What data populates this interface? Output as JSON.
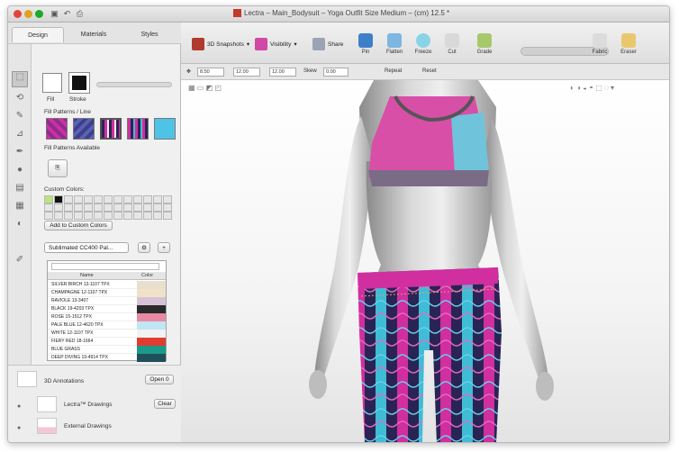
{
  "window": {
    "title": "Lectra – Main_Bodysuit – Yoga Outfit Size Medium – (cm) 12.5 *"
  },
  "tabs": [
    {
      "label": "Design"
    },
    {
      "label": "Materials"
    },
    {
      "label": "Styles"
    }
  ],
  "toolbar": {
    "snapshots_label": "3D Snapshots",
    "visibility_label": "Visibility",
    "share_label": "Share",
    "tools": [
      {
        "label": "Pin"
      },
      {
        "label": "Flatten"
      },
      {
        "label": "Freeze"
      },
      {
        "label": "Cut"
      },
      {
        "label": "Grade"
      },
      {
        "label": "Fabric"
      },
      {
        "label": "Eraser"
      }
    ]
  },
  "properties": {
    "size_value": "8.50",
    "width_value": "12.00",
    "height_value": "12.00",
    "skew_label": "Skew",
    "angle_value": "0.00",
    "repeat_label": "Repeat",
    "reset_label": "Reset"
  },
  "fill_panel": {
    "fill_label": "Fill",
    "stroke_label": "Stroke",
    "patterns_label": "Fill Patterns / Line",
    "recent_label": "Fill Patterns Available",
    "custom_colors_label": "Custom Colors:",
    "add_custom_button": "Add to Custom Colors",
    "library_select": "Sublimated CC400 Pal...",
    "table_headers": {
      "name": "Name",
      "color": "Color"
    },
    "colors": [
      {
        "name": "SILVER BIRCH 13-1107 TPX",
        "hex": "#e9dfce"
      },
      {
        "name": "CHAMPAGNE 12-1107 TPX",
        "hex": "#f0e2c8"
      },
      {
        "name": "RAVIOLE 13-3407",
        "hex": "#d5c2d8"
      },
      {
        "name": "BLACK 19-4203 TPX",
        "hex": "#2a2a2a"
      },
      {
        "name": "ROSE 15-1512 TPX",
        "hex": "#e88aa4"
      },
      {
        "name": "PALE BLUE 12-4620 TPX",
        "hex": "#bfe6f2"
      },
      {
        "name": "WHITE 12-1107 TPX",
        "hex": "#f2f2f2"
      },
      {
        "name": "FIERY RED 18-1664",
        "hex": "#e03c31"
      },
      {
        "name": "BLUE GRASS",
        "hex": "#1a9a8a"
      },
      {
        "name": "DEEP DIVING 19-4914 TPX",
        "hex": "#1f4f59"
      }
    ],
    "grid_first_colors": [
      "#b8e67a",
      "#111111"
    ]
  },
  "bottom": {
    "annotations_label": "3D Annotations",
    "open_button": "Open",
    "open_count": "0",
    "latest_drawing": "Lectra™ Drawings",
    "clear_button": "Clear",
    "external_drawing": "External Drawings"
  },
  "colors": {
    "top_pink": "#d84fa8",
    "top_blue": "#6fc3db",
    "band": "#7a6c86",
    "legging_pink": "#d12ea0",
    "legging_teal": "#3fbcd6",
    "legging_navy": "#2a2455"
  }
}
